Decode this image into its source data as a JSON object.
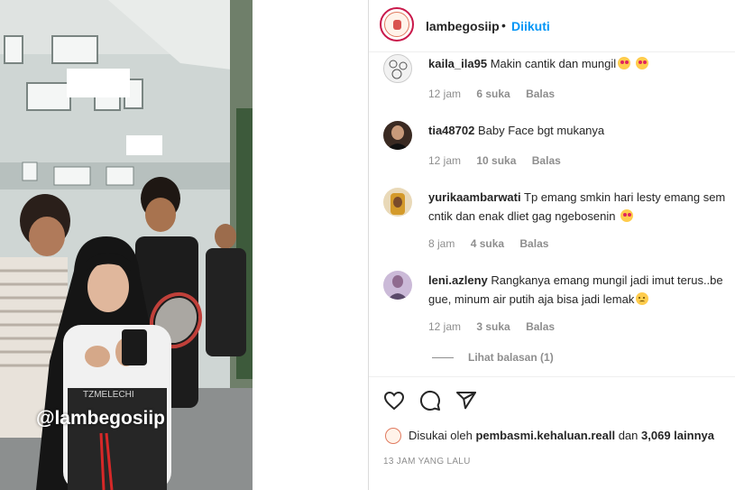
{
  "post": {
    "account": "lambegosiip",
    "follow_state": "Diikuti",
    "separator": "•",
    "watermark": "@lambegosiip",
    "sub_watermark": "TZMELECHI"
  },
  "comments": [
    {
      "user": "kaila_ila95",
      "text": "Makin cantik dan mungil",
      "emoji": "heart-eyes-emoji x2",
      "time": "12 jam",
      "likes": "6 suka",
      "reply": "Balas"
    },
    {
      "user": "tia48702",
      "text": "Baby Face bgt mukanya",
      "time": "12 jam",
      "likes": "10 suka",
      "reply": "Balas"
    },
    {
      "user": "yurikaambarwati",
      "text": "Tp emang smkin hari lesty emang sem",
      "text2": "cntik dan enak dliet gag ngebosenin",
      "emoji": "heart-eyes-emoji",
      "time": "8 jam",
      "likes": "4 suka",
      "reply": "Balas"
    },
    {
      "user": "leni.azleny",
      "text": "Rangkanya emang mungil jadi imut terus..be",
      "text2": "gue, minum air putih aja bisa jadi lemak",
      "emoji": "pleading-face-emoji",
      "time": "12 jam",
      "likes": "3 suka",
      "reply": "Balas",
      "view_replies": "Lihat balasan (1)"
    }
  ],
  "likes": {
    "prefix": "Disukai oleh",
    "user": "pembasmi.kehaluan.reall",
    "middle": "dan",
    "count": "3,069 lainnya"
  },
  "timestamp": "13 JAM YANG LALU",
  "colors": {
    "link": "#0095f6",
    "text": "#262626",
    "muted": "#8e8e8e",
    "ring": "#c9184a"
  }
}
